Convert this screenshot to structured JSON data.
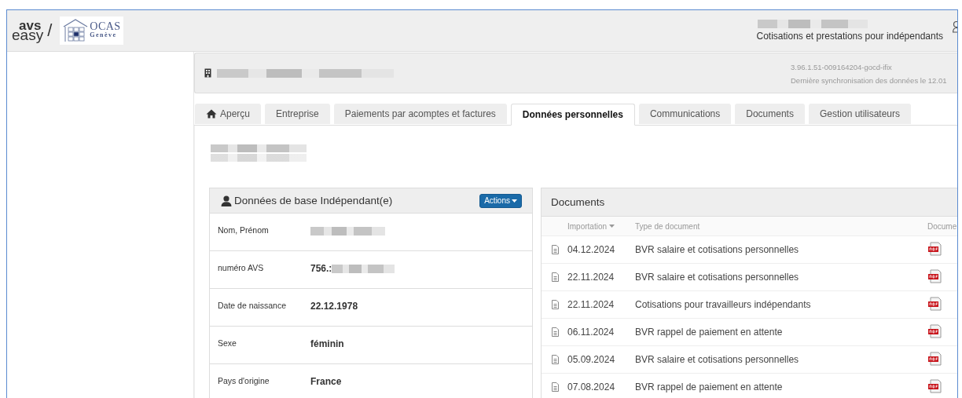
{
  "header": {
    "logo": {
      "avs": "avs",
      "easy": "easy",
      "slash": "/",
      "ocas": "OCAS",
      "geneve": "Genève"
    },
    "subtitle": "Cotisations et prestations pour indépendants"
  },
  "info_bar": {
    "version": "3.96.1.51-009164204-gocd-ifix",
    "sync": "Dernière synchronisation des données le 12.01"
  },
  "tabs": [
    {
      "label": "Aperçu",
      "selected": false
    },
    {
      "label": "Entreprise",
      "selected": false
    },
    {
      "label": "Paiements par acomptes et factures",
      "selected": false
    },
    {
      "label": "Données personnelles",
      "selected": true
    },
    {
      "label": "Communications",
      "selected": false
    },
    {
      "label": "Documents",
      "selected": false
    },
    {
      "label": "Gestion utilisateurs",
      "selected": false
    }
  ],
  "base_panel": {
    "title": "Données de base Indépendant(e)",
    "action": "Actions",
    "rows": [
      {
        "label": "Nom, Prénom"
      },
      {
        "label": "numéro AVS",
        "value": "756.:"
      },
      {
        "label": "Date de naissance",
        "value": "22.12.1978"
      },
      {
        "label": "Sexe",
        "value": "féminin"
      },
      {
        "label": "Pays d'origine",
        "value": "France"
      }
    ]
  },
  "documents_panel": {
    "title": "Documents",
    "columns": [
      "Importation",
      "Type de document",
      "Docume"
    ],
    "rows": [
      {
        "date": "04.12.2024",
        "type": "BVR salaire et cotisations personnelles"
      },
      {
        "date": "22.11.2024",
        "type": "BVR salaire et cotisations personnelles"
      },
      {
        "date": "22.11.2024",
        "type": "Cotisations pour travailleurs indépendants"
      },
      {
        "date": "06.11.2024",
        "type": "BVR rappel de paiement en attente"
      },
      {
        "date": "05.09.2024",
        "type": "BVR salaire et cotisations personnelles"
      },
      {
        "date": "07.08.2024",
        "type": "BVR rappel de paiement en attente"
      }
    ]
  }
}
